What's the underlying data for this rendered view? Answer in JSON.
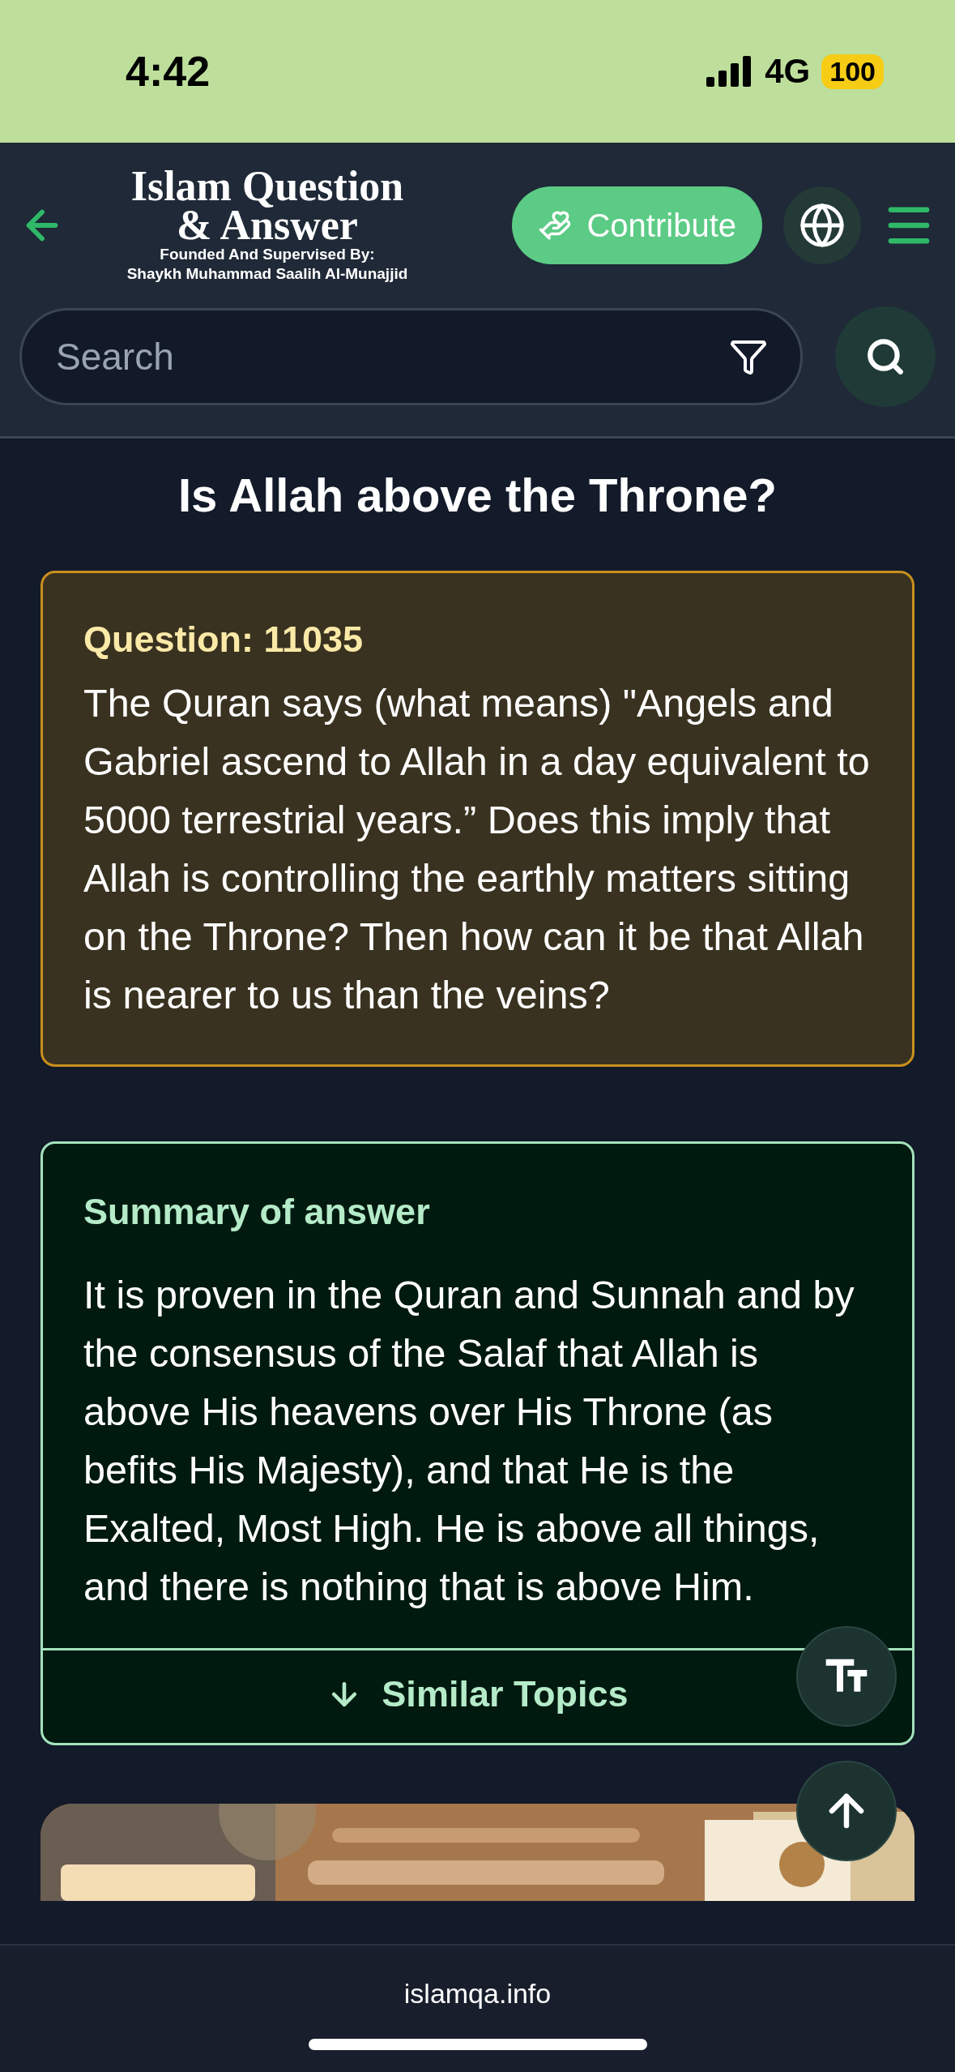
{
  "status_bar": {
    "time": "4:42",
    "network": "4G",
    "battery": "100"
  },
  "header": {
    "logo_title": "Islam Question & Answer",
    "logo_subtitle_1": "Founded And Supervised By:",
    "logo_subtitle_2": "Shaykh Muhammad Saalih Al-Munajjid",
    "contribute": "Contribute"
  },
  "search": {
    "placeholder": "Search"
  },
  "page_title": "Is Allah above the Throne?",
  "question": {
    "heading": "Question: 11035",
    "text": "The Quran says (what means) \"Angels and Gabriel ascend to Allah in a day equivalent to 5000 terrestrial years.” Does this imply that Allah is controlling the earthly matters sitting on the Throne? Then how can it be that Allah is nearer to us than the veins?"
  },
  "summary": {
    "heading": "Summary of answer",
    "text": "It is proven in the Quran and Sunnah and by the consensus of the Salaf that Allah is above His heavens over His Throne (as befits His Majesty), and that He is the Exalted, Most High. He is above all things, and there is nothing that is above Him.",
    "link": "Similar Topics"
  },
  "browser_bar": {
    "url": "islamqa.info"
  }
}
